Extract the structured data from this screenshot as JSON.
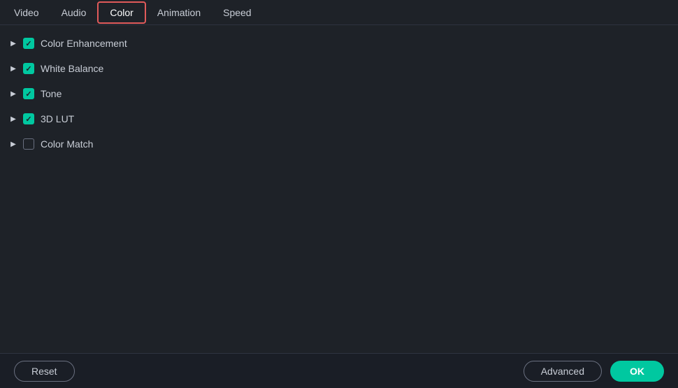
{
  "nav": {
    "items": [
      {
        "id": "video",
        "label": "Video",
        "active": false
      },
      {
        "id": "audio",
        "label": "Audio",
        "active": false
      },
      {
        "id": "color",
        "label": "Color",
        "active": true
      },
      {
        "id": "animation",
        "label": "Animation",
        "active": false
      },
      {
        "id": "speed",
        "label": "Speed",
        "active": false
      }
    ]
  },
  "sections": [
    {
      "id": "color-enhancement",
      "label": "Color Enhancement",
      "checked": true
    },
    {
      "id": "white-balance",
      "label": "White Balance",
      "checked": true
    },
    {
      "id": "tone",
      "label": "Tone",
      "checked": true
    },
    {
      "id": "3d-lut",
      "label": "3D LUT",
      "checked": true
    },
    {
      "id": "color-match",
      "label": "Color Match",
      "checked": false
    }
  ],
  "buttons": {
    "reset": "Reset",
    "advanced": "Advanced",
    "ok": "OK"
  }
}
